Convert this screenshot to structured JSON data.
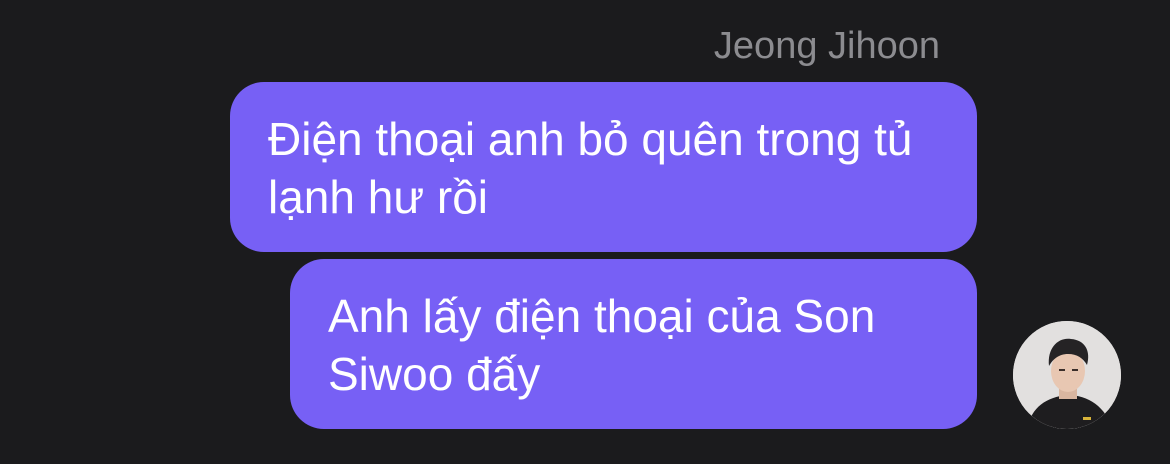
{
  "conversation": {
    "sender_name": "Jeong Jihoon",
    "messages": [
      {
        "text": "Điện thoại anh bỏ quên trong tủ lạnh hư rồi"
      },
      {
        "text": "Anh lấy điện thoại của Son Siwoo đấy"
      }
    ]
  },
  "colors": {
    "background": "#1b1b1d",
    "bubble": "#7760f5",
    "sender_name": "#8c8c90",
    "message_text": "#ffffff"
  },
  "icons": {
    "avatar": "profile-photo"
  }
}
